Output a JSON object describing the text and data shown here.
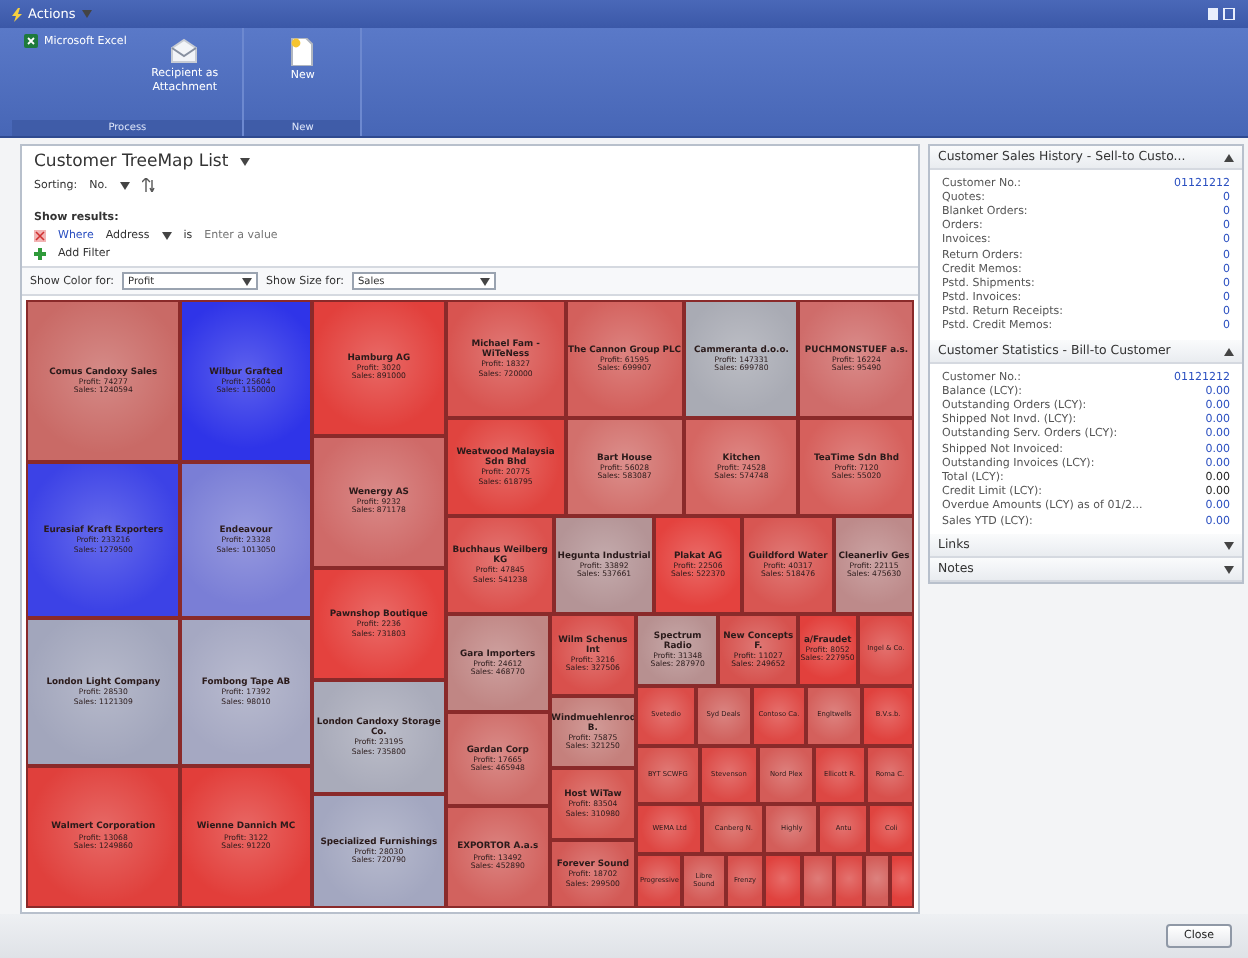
{
  "window": {
    "title": "Actions"
  },
  "ribbon": {
    "groups": [
      {
        "label": "Process",
        "buttons": [
          {
            "label": "Microsoft Excel",
            "kind": "small"
          },
          {
            "label": "Recipient as Attachment",
            "kind": "large"
          }
        ]
      },
      {
        "label": "New",
        "buttons": [
          {
            "label": "New",
            "kind": "large"
          }
        ]
      }
    ]
  },
  "page": {
    "title": "Customer TreeMap List",
    "sorting_label": "Sorting:",
    "sorting_value": "No."
  },
  "filter": {
    "heading": "Show results:",
    "where": "Where",
    "field": "Address",
    "operator": "is",
    "placeholder": "Enter a value",
    "add": "Add Filter"
  },
  "options": {
    "color_label": "Show Color for:",
    "color_value": "Profit",
    "size_label": "Show Size for:",
    "size_value": "Sales"
  },
  "treemap": {
    "tiles": [
      {
        "name": "Comus Candoxy Sales",
        "profit": "Profit: 74277",
        "sales": "Sales: 1240594",
        "color": "#c96a66"
      },
      {
        "name": "Eurasiaf Kraft Exporters",
        "profit": "Profit: 233216",
        "sales": "Sales: 1279500",
        "color": "#3c42e6"
      },
      {
        "name": "London Light Company",
        "profit": "Profit: 28530",
        "sales": "Sales: 1121309",
        "color": "#a2a6bc"
      },
      {
        "name": "Walmert Corporation",
        "profit": "Profit: 13068",
        "sales": "Sales: 1249860",
        "color": "#e0403c"
      },
      {
        "name": "Wilbur Grafted",
        "profit": "Profit: 25604",
        "sales": "Sales: 1150000",
        "color": "#2f34e8"
      },
      {
        "name": "Endeavour",
        "profit": "Profit: 23328",
        "sales": "Sales: 1013050",
        "color": "#7a7ed6"
      },
      {
        "name": "Fombong Tape AB",
        "profit": "Profit: 17392",
        "sales": "Sales: 98010",
        "color": "#a5a8c2"
      },
      {
        "name": "Wienne Dannich MC",
        "profit": "Profit: 3122",
        "sales": "Sales: 91220",
        "color": "#e23e3a"
      },
      {
        "name": "Hamburg AG",
        "profit": "Profit: 3020",
        "sales": "Sales: 891000",
        "color": "#e2403c"
      },
      {
        "name": "Wenergy AS",
        "profit": "Profit: 9232",
        "sales": "Sales: 871178",
        "color": "#cf6a68"
      },
      {
        "name": "Pawnshop Boutique",
        "profit": "Profit: 2236",
        "sales": "Sales: 731803",
        "color": "#e4423e"
      },
      {
        "name": "London Candoxy Storage Co.",
        "profit": "Profit: 23195",
        "sales": "Sales: 735800",
        "color": "#a9abba"
      },
      {
        "name": "Specialized Furnishings",
        "profit": "Profit: 28030",
        "sales": "Sales: 720790",
        "color": "#a3a7c0"
      },
      {
        "name": "Michael Fam - WiTeNess",
        "profit": "Profit: 18327",
        "sales": "Sales: 720000",
        "color": "#d85450"
      },
      {
        "name": "The Cannon Group PLC",
        "profit": "Profit: 61595",
        "sales": "Sales: 699907",
        "color": "#d3605c"
      },
      {
        "name": "Cammeranta d.o.o.",
        "profit": "Profit: 147331",
        "sales": "Sales: 699780",
        "color": "#a9abb4"
      },
      {
        "name": "PUCHMONSTUEF a.s.",
        "profit": "Profit: 16224",
        "sales": "Sales: 95490",
        "color": "#cf6c6a"
      },
      {
        "name": "Weatwood Malaysia Sdn Bhd",
        "profit": "Profit: 20775",
        "sales": "Sales: 618795",
        "color": "#e0443f"
      },
      {
        "name": "Bart House",
        "profit": "Profit: 56028",
        "sales": "Sales: 583087",
        "color": "#d2706c"
      },
      {
        "name": "Kitchen",
        "profit": "Profit: 74528",
        "sales": "Sales: 574748",
        "color": "#d56662"
      },
      {
        "name": "TeaTime Sdn Bhd",
        "profit": "Profit: 7120",
        "sales": "Sales: 55020",
        "color": "#d6605c"
      },
      {
        "name": "Buchhaus Weilberg KG",
        "profit": "Profit: 47845",
        "sales": "Sales: 541238",
        "color": "#dc514d"
      },
      {
        "name": "Hegunta Industrial",
        "profit": "Profit: 33892",
        "sales": "Sales: 537661",
        "color": "#b49496"
      },
      {
        "name": "Plakat AG",
        "profit": "Profit: 22506",
        "sales": "Sales: 522370",
        "color": "#e4423e"
      },
      {
        "name": "Guildford Water",
        "profit": "Profit: 40317",
        "sales": "Sales: 518476",
        "color": "#d85652"
      },
      {
        "name": "Cleanerliv Ges",
        "profit": "Profit: 22115",
        "sales": "Sales: 475630",
        "color": "#bd8a8a"
      },
      {
        "name": "Gara Importers",
        "profit": "Profit: 24612",
        "sales": "Sales: 468770",
        "color": "#c08684"
      },
      {
        "name": "Gardan Corp",
        "profit": "Profit: 17665",
        "sales": "Sales: 465948",
        "color": "#cf6c68"
      },
      {
        "name": "EXPORTOR A.a.s",
        "profit": "Profit: 13492",
        "sales": "Sales: 452890",
        "color": "#d2625e"
      },
      {
        "name": "Wilm Schenus Int",
        "profit": "Profit: 3216",
        "sales": "Sales: 327506",
        "color": "#d9504c"
      },
      {
        "name": "Windmuehlenrod B.",
        "profit": "Profit: 75875",
        "sales": "Sales: 321250",
        "color": "#c5807c"
      },
      {
        "name": "Host WiTaw",
        "profit": "Profit: 83504",
        "sales": "Sales: 310980",
        "color": "#d65852"
      },
      {
        "name": "Forever Sound",
        "profit": "Profit: 18702",
        "sales": "Sales: 299500",
        "color": "#d35a56"
      },
      {
        "name": "Spectrum Radio",
        "profit": "Profit: 31348",
        "sales": "Sales: 287970",
        "color": "#b79090"
      },
      {
        "name": "New Concepts F.",
        "profit": "Profit: 11027",
        "sales": "Sales: 249652",
        "color": "#d6524e"
      },
      {
        "name": "a/Fraudet",
        "profit": "Profit: 8052",
        "sales": "Sales: 227950",
        "color": "#e2403c"
      },
      {
        "name": "Ingel & Co.",
        "color": "#dc4a46"
      },
      {
        "name": "Svetedio",
        "color": "#dc4c48"
      },
      {
        "name": "Syd Deals",
        "color": "#d0625e"
      },
      {
        "name": "Contoso Ca.",
        "color": "#de4844"
      },
      {
        "name": "Engltwells",
        "color": "#d4605c"
      },
      {
        "name": "B.V.s.b.",
        "color": "#e0423e"
      },
      {
        "name": "BYT SCWFG",
        "color": "#d8544f"
      },
      {
        "name": "Stevenson",
        "color": "#dc4a46"
      },
      {
        "name": "Nord Plex",
        "color": "#d45c58"
      },
      {
        "name": "Ellicott R.",
        "color": "#dd4743"
      },
      {
        "name": "Roma C.",
        "color": "#d8504c"
      },
      {
        "name": "WEMA Ltd",
        "color": "#de4642"
      },
      {
        "name": "Canberg N.",
        "color": "#d65852"
      },
      {
        "name": "Highly",
        "color": "#d35e5a"
      },
      {
        "name": "Antu",
        "color": "#dc4c48"
      },
      {
        "name": "Coli",
        "color": "#e0443f"
      },
      {
        "name": "Progressive",
        "color": "#dc4945"
      },
      {
        "name": "Libre Sound",
        "color": "#d45a56"
      },
      {
        "name": "Frenzy",
        "color": "#d8524e"
      },
      {
        "color": "#e0423e"
      },
      {
        "color": "#d65652"
      },
      {
        "color": "#dc4a46"
      },
      {
        "color": "#d35e5a"
      },
      {
        "color": "#e2403c"
      }
    ]
  },
  "factboxes": [
    {
      "title": "Customer Sales History - Sell-to Custo...",
      "expanded": true,
      "rows": [
        {
          "label": "Customer No.:",
          "value": "01121212",
          "link": true
        },
        {
          "label": "Quotes:",
          "value": "0",
          "link": true
        },
        {
          "label": "Blanket Orders:",
          "value": "0",
          "link": true
        },
        {
          "label": "Orders:",
          "value": "0",
          "link": true
        },
        {
          "label": "Invoices:",
          "value": "0",
          "link": true
        },
        {
          "label": "Return Orders:",
          "value": "0",
          "link": true
        },
        {
          "label": "Credit Memos:",
          "value": "0",
          "link": true
        },
        {
          "label": "Pstd. Shipments:",
          "value": "0",
          "link": true
        },
        {
          "label": "Pstd. Invoices:",
          "value": "0",
          "link": true
        },
        {
          "label": "Pstd. Return Receipts:",
          "value": "0",
          "link": true
        },
        {
          "label": "Pstd. Credit Memos:",
          "value": "0",
          "link": true
        }
      ]
    },
    {
      "title": "Customer Statistics - Bill-to Customer",
      "expanded": true,
      "rows": [
        {
          "label": "Customer No.:",
          "value": "01121212",
          "link": true
        },
        {
          "label": "Balance (LCY):",
          "value": "0.00",
          "link": true
        },
        {
          "label": "Outstanding Orders (LCY):",
          "value": "0.00",
          "link": true
        },
        {
          "label": "Shipped Not Invd. (LCY):",
          "value": "0.00",
          "link": true
        },
        {
          "label": "Outstanding Serv. Orders (LCY):",
          "value": "0.00",
          "link": true
        },
        {
          "label": "Shipped Not Invoiced:",
          "value": "0.00",
          "link": true
        },
        {
          "label": "Outstanding Invoices (LCY):",
          "value": "0.00",
          "link": true
        },
        {
          "label": "Total (LCY):",
          "value": "0.00",
          "link": false
        },
        {
          "label": "Credit Limit (LCY):",
          "value": "0.00",
          "link": false
        },
        {
          "label": "Overdue Amounts (LCY) as of 01/2...",
          "value": "0.00",
          "link": true
        },
        {
          "label": "Sales YTD (LCY):",
          "value": "0.00",
          "link": true
        }
      ]
    },
    {
      "title": "Links",
      "expanded": false
    },
    {
      "title": "Notes",
      "expanded": false
    }
  ],
  "footer": {
    "close": "Close"
  }
}
